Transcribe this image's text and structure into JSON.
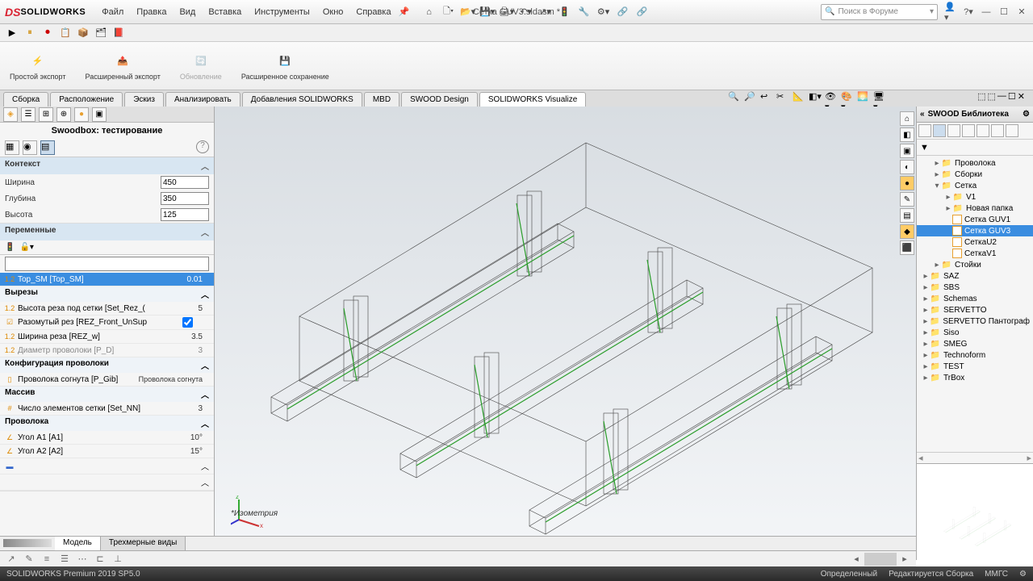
{
  "app": {
    "logo_text": "SOLIDWORKS",
    "title": "Сетка GUV3.sldasm *",
    "version": "SOLIDWORKS Premium 2019 SP5.0"
  },
  "menu": {
    "file": "Файл",
    "edit": "Правка",
    "view": "Вид",
    "insert": "Вставка",
    "tools": "Инструменты",
    "window": "Окно",
    "help": "Справка"
  },
  "search": {
    "placeholder": "Поиск в Форуме"
  },
  "ribbon": {
    "g1": "Простой\nэкспорт",
    "g2": "Расширенный\nэкспорт",
    "g3": "Обновление",
    "g4": "Расширенное\nсохранение"
  },
  "tabs": {
    "t1": "Сборка",
    "t2": "Расположение",
    "t3": "Эскиз",
    "t4": "Анализировать",
    "t5": "Добавления SOLIDWORKS",
    "t6": "MBD",
    "t7": "SWOOD Design",
    "t8": "SOLIDWORKS Visualize"
  },
  "left": {
    "title": "Swoodbox: тестирование",
    "sec_context": "Контекст",
    "ctx_w": "Ширина",
    "ctx_w_v": "450",
    "ctx_d": "Глубина",
    "ctx_d_v": "350",
    "ctx_h": "Высота",
    "ctx_h_v": "125",
    "sec_vars": "Переменные",
    "var_selected": "Top_SM [Top_SM]",
    "var_selected_v": "0.01",
    "sec_cuts": "Вырезы",
    "cut1": "Высота реза под сетки  [Set_Rez_(",
    "cut1_v": "5",
    "cut2": "Разомутый рез [REZ_Front_UnSup",
    "cut3": "Ширина реза [REZ_w]",
    "cut3_v": "3.5",
    "cut4": "Диаметр проволоки [P_D]",
    "cut4_v": "3",
    "sec_wire": "Конфигурация проволоки",
    "wire1": "Проволока согнута [P_Gib]",
    "wire1_v": "Проволока согнута",
    "sec_array": "Массив",
    "arr1": "Число элементов сетки [Set_NN]",
    "arr1_v": "3",
    "sec_wire2": "Проволока",
    "ang1": "Угол A1 [A1]",
    "ang1_v": "10°",
    "ang2": "Угол A2 [A2]",
    "ang2_v": "15°"
  },
  "viewport": {
    "label": "*Изометрия"
  },
  "library": {
    "title": "SWOOD Библиотека",
    "items": [
      {
        "name": "Проволока",
        "depth": 1,
        "type": "folder",
        "exp": "▸"
      },
      {
        "name": "Сборки",
        "depth": 1,
        "type": "folder",
        "exp": "▸"
      },
      {
        "name": "Сетка",
        "depth": 1,
        "type": "folder",
        "exp": "▾"
      },
      {
        "name": "V1",
        "depth": 2,
        "type": "folder",
        "exp": "▸"
      },
      {
        "name": "Новая папка",
        "depth": 2,
        "type": "folder",
        "exp": "▸"
      },
      {
        "name": "Сетка GUV1",
        "depth": 2,
        "type": "file"
      },
      {
        "name": "Сетка GUV3",
        "depth": 2,
        "type": "file",
        "selected": true
      },
      {
        "name": "СеткаU2",
        "depth": 2,
        "type": "file"
      },
      {
        "name": "СеткаV1",
        "depth": 2,
        "type": "file"
      },
      {
        "name": "Стойки",
        "depth": 1,
        "type": "folder",
        "exp": "▸"
      },
      {
        "name": "SAZ",
        "depth": 0,
        "type": "folder",
        "exp": "▸"
      },
      {
        "name": "SBS",
        "depth": 0,
        "type": "folder",
        "exp": "▸"
      },
      {
        "name": "Schemas",
        "depth": 0,
        "type": "folder",
        "exp": "▸"
      },
      {
        "name": "SERVETTO",
        "depth": 0,
        "type": "folder",
        "exp": "▸"
      },
      {
        "name": "SERVETTO Пантограф",
        "depth": 0,
        "type": "folder",
        "exp": "▸"
      },
      {
        "name": "Siso",
        "depth": 0,
        "type": "folder",
        "exp": "▸"
      },
      {
        "name": "SMEG",
        "depth": 0,
        "type": "folder",
        "exp": "▸"
      },
      {
        "name": "Technoform",
        "depth": 0,
        "type": "folder",
        "exp": "▸"
      },
      {
        "name": "TEST",
        "depth": 0,
        "type": "folder",
        "exp": "▸"
      },
      {
        "name": "TrBox",
        "depth": 0,
        "type": "folder",
        "exp": "▸"
      }
    ]
  },
  "bottom_tabs": {
    "t1": "Модель",
    "t2": "Трехмерные виды"
  },
  "status": {
    "s1": "Определенный",
    "s2": "Редактируется Сборка",
    "s3": "ММГС"
  }
}
